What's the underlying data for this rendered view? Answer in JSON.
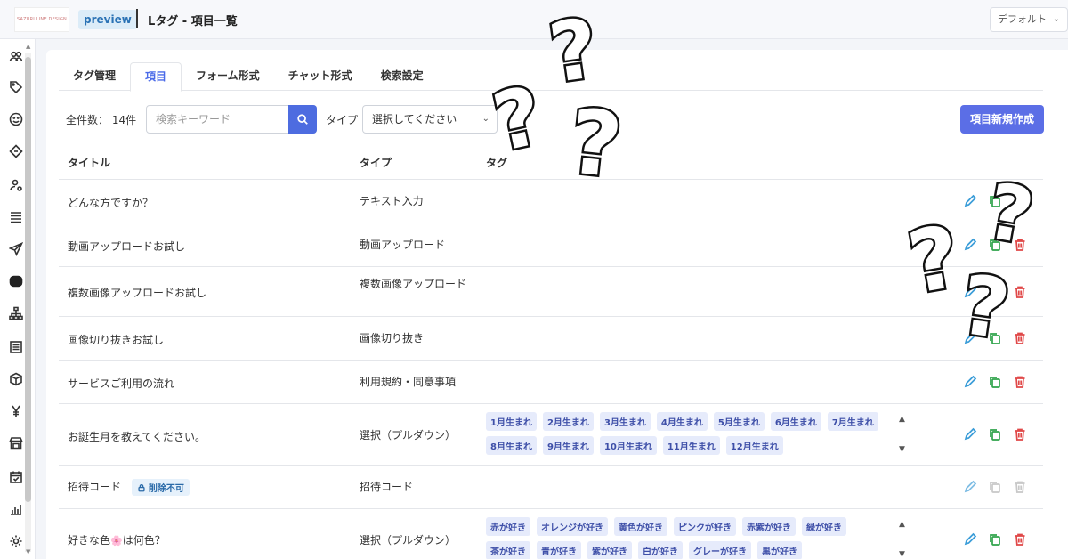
{
  "header": {
    "logo_text": "SAZURI LINE DESIGN",
    "preview_badge": "preview",
    "title": "Lタグ - 項目一覧",
    "default_select": "デフォルト"
  },
  "sidebar": {
    "icons": [
      "users-icon",
      "tag-icon",
      "smile-icon",
      "diamond-tag-icon",
      "user-settings-icon",
      "list-icon",
      "send-icon",
      "line-icon",
      "hierarchy-icon",
      "document-icon",
      "box-icon",
      "yen-icon",
      "store-icon",
      "calendar-icon",
      "bar-chart-icon",
      "gear-icon"
    ]
  },
  "tabs": [
    {
      "label": "タグ管理",
      "active": false
    },
    {
      "label": "項目",
      "active": true
    },
    {
      "label": "フォーム形式",
      "active": false
    },
    {
      "label": "チャット形式",
      "active": false
    },
    {
      "label": "検索設定",
      "active": false
    }
  ],
  "toolbar": {
    "total_label": "全件数： 14件",
    "search_placeholder": "検索キーワード",
    "type_label": "タイプ",
    "type_select_value": "選択してください",
    "new_button": "項目新規作成"
  },
  "table": {
    "headers": {
      "title": "タイトル",
      "type": "タイプ",
      "tag": "タグ"
    },
    "rows": [
      {
        "title": "どんな方ですか？",
        "type": "テキスト入力",
        "tags": []
      },
      {
        "title": "動画アップロードお試し",
        "type": "動画アップロード",
        "tags": []
      },
      {
        "title": "複数画像アップロードお試し",
        "type": "複数画像アップロード",
        "tags": []
      },
      {
        "title": "画像切り抜きお試し",
        "type": "画像切り抜き",
        "tags": []
      },
      {
        "title": "サービスご利用の流れ",
        "type": "利用規約・同意事項",
        "tags": []
      },
      {
        "title": "お誕生月を教えてください。",
        "type": "選択（プルダウン）",
        "tags": [
          "1月生まれ",
          "2月生まれ",
          "3月生まれ",
          "4月生まれ",
          "5月生まれ",
          "6月生まれ",
          "7月生まれ",
          "8月生まれ",
          "9月生まれ",
          "10月生まれ",
          "11月生まれ",
          "12月生まれ"
        ]
      },
      {
        "title": "招待コード",
        "badge": "削除不可",
        "type": "招待コード",
        "tags": []
      },
      {
        "title_prefix": "好きな色",
        "title_emoji": "🌸",
        "title_suffix": "は何色？",
        "type": "選択（プルダウン）",
        "tags": [
          "赤が好き",
          "オレンジが好き",
          "黄色が好き",
          "ピンクが好き",
          "赤紫が好き",
          "緑が好き",
          "茶が好き",
          "青が好き",
          "紫が好き",
          "白が好き",
          "グレーが好き",
          "黒が好き"
        ]
      }
    ]
  },
  "overlay": {
    "question_mark": "?"
  }
}
